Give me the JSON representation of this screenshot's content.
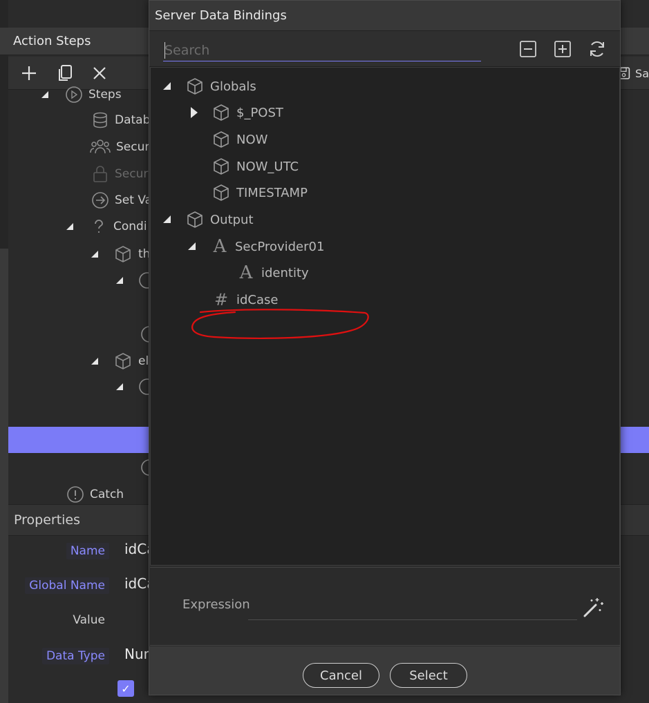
{
  "background": {
    "panel_title": "Action Steps",
    "save_label": "Sa",
    "toolbar": {
      "add_label": "add",
      "copy_label": "copy",
      "delete_label": "delete"
    },
    "tree": [
      {
        "label": "Steps",
        "icon": "play-circle-icon"
      },
      {
        "label": "Datab",
        "icon": "database-icon"
      },
      {
        "label": "Secur",
        "icon": "users-icon"
      },
      {
        "label": "Secur",
        "icon": "lock-icon"
      },
      {
        "label": "Set Va",
        "icon": "arrow-right-circle-icon"
      },
      {
        "label": "Condi",
        "icon": "question-icon"
      },
      {
        "label": "th",
        "icon": "cube-icon"
      },
      {
        "label": "el",
        "icon": "cube-icon"
      },
      {
        "label": "Catch",
        "icon": "exclamation-circle-icon"
      }
    ],
    "properties": {
      "header": "Properties",
      "rows": [
        {
          "label": "Name",
          "value": "idCas"
        },
        {
          "label": "Global Name",
          "value": "idCas"
        },
        {
          "label": "Value",
          "value": ""
        },
        {
          "label": "Data Type",
          "value": "Num"
        }
      ]
    }
  },
  "dialog": {
    "title": "Server Data Bindings",
    "search_placeholder": "Search",
    "tools": {
      "collapse": "minus-square-icon",
      "expand": "plus-square-icon",
      "refresh": "refresh-icon"
    },
    "tree": [
      {
        "label": "Globals",
        "icon": "cube-icon",
        "expander": "expanded",
        "level": 0
      },
      {
        "label": "$_POST",
        "icon": "cube-icon",
        "expander": "collapsed",
        "level": 1
      },
      {
        "label": "NOW",
        "icon": "cube-icon",
        "expander": "none",
        "level": 1
      },
      {
        "label": "NOW_UTC",
        "icon": "cube-icon",
        "expander": "none",
        "level": 1
      },
      {
        "label": "TIMESTAMP",
        "icon": "cube-icon",
        "expander": "none",
        "level": 1
      },
      {
        "label": "Output",
        "icon": "cube-icon",
        "expander": "expanded",
        "level": 0
      },
      {
        "label": "SecProvider01",
        "icon": "text-icon",
        "expander": "expanded",
        "level": 1
      },
      {
        "label": "identity",
        "icon": "text-icon",
        "expander": "none",
        "level": 2
      },
      {
        "label": "idCase",
        "icon": "number-icon",
        "expander": "none",
        "level": 1
      }
    ],
    "expression_label": "Expression",
    "expression_value": "",
    "cancel_label": "Cancel",
    "select_label": "Select"
  },
  "colors": {
    "accent": "#7b7bf7",
    "annotation": "#e01010"
  }
}
